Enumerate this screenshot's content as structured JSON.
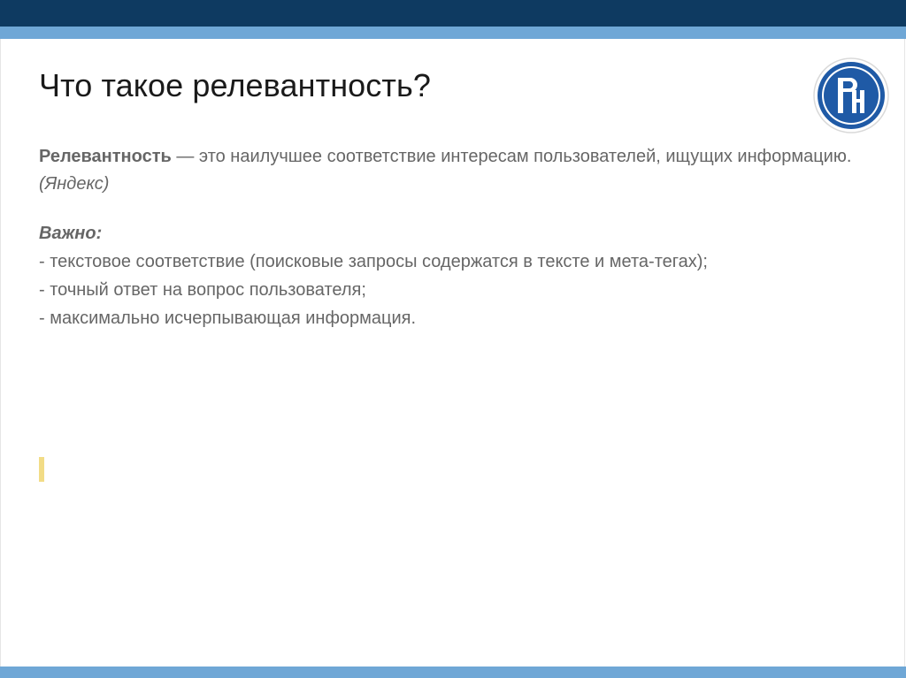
{
  "slide": {
    "title": "Что такое релевантность?",
    "definition": {
      "term": "Релевантность",
      "text": " — это наилучшее соответствие интересам пользователей, ищущих информацию. ",
      "source": "(Яндекс)"
    },
    "important": {
      "label": "Важно:",
      "items": [
        "- текстовое соответствие (поисковые запросы содержатся в тексте и мета-тегах);",
        "- точный ответ  на вопрос пользователя;",
        "- максимально исчерпывающая информация."
      ]
    }
  },
  "colors": {
    "header_dark": "#0e3a61",
    "header_light": "#6fa7d6",
    "text_gray": "#666666",
    "logo_blue": "#1f5aa6",
    "marker_yellow": "#f2dc86"
  },
  "icons": {
    "logo": "hse-university-logo"
  }
}
